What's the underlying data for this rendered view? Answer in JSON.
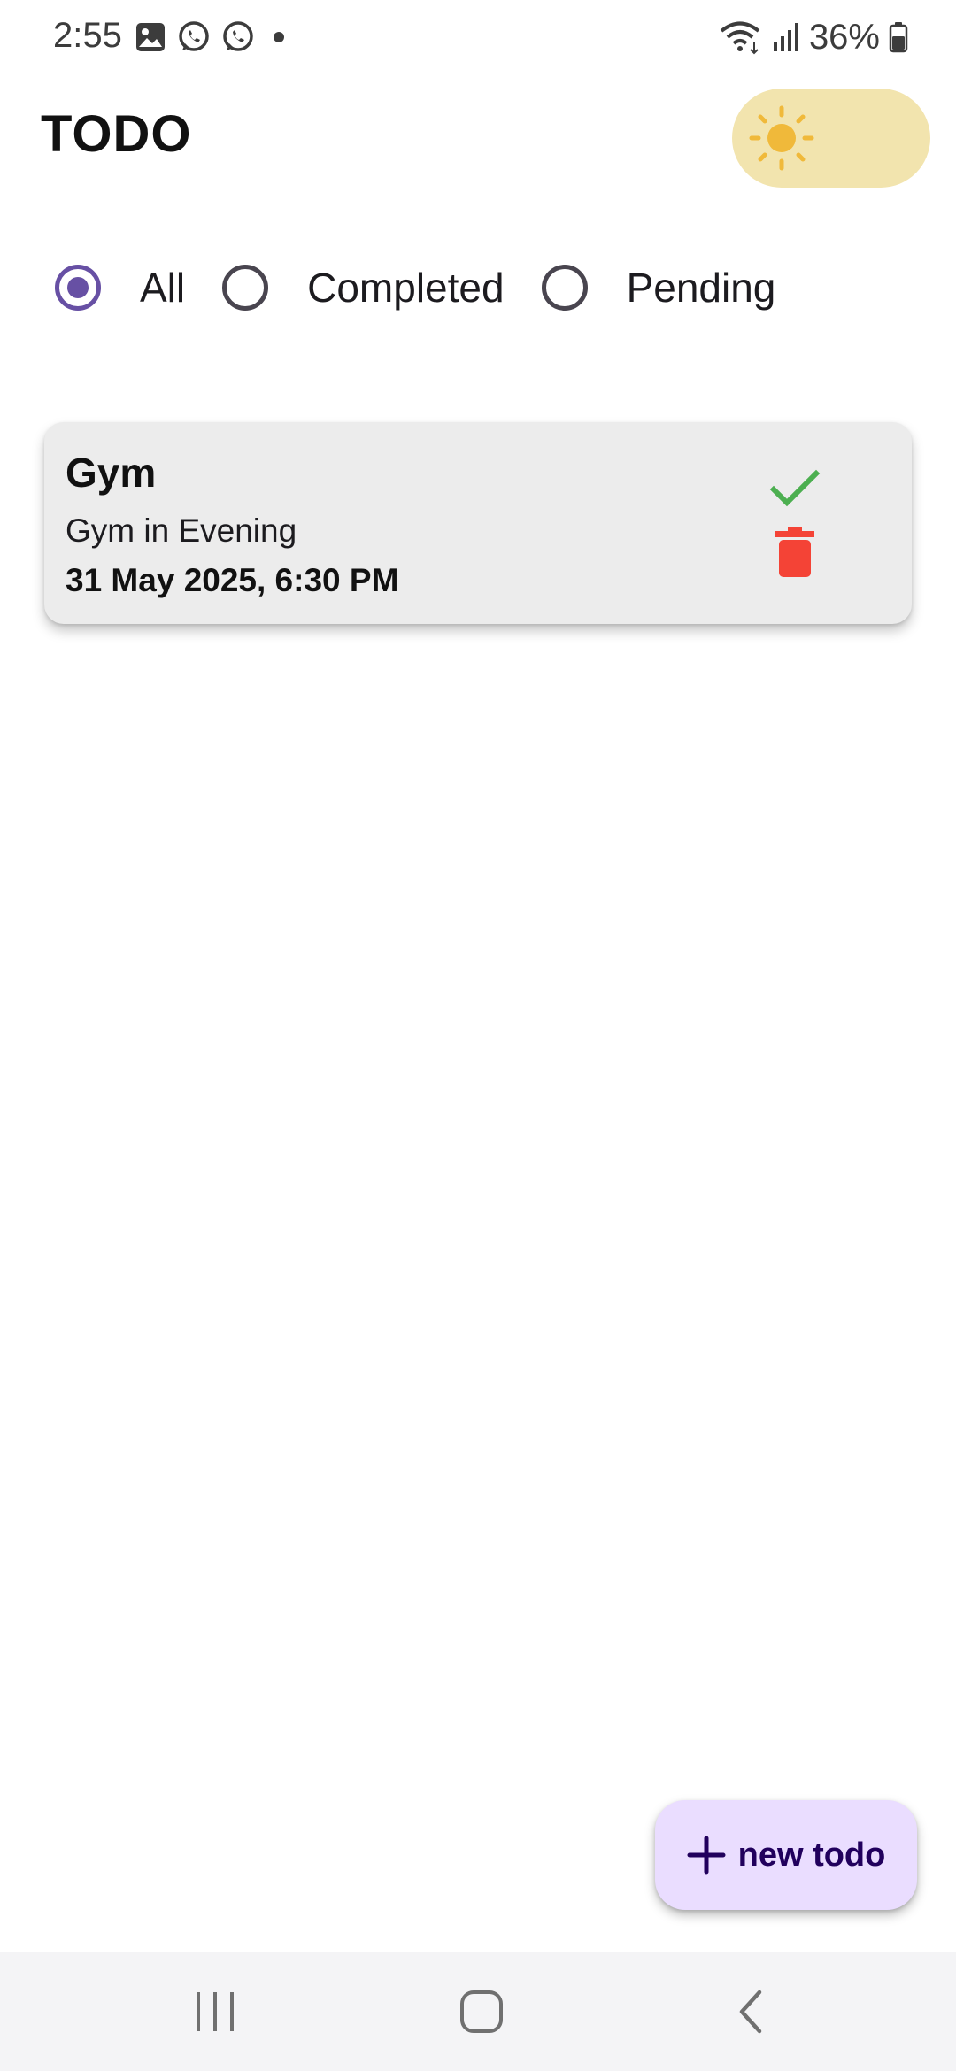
{
  "status_bar": {
    "time": "2:55",
    "battery_percent": "36%",
    "left_icons": [
      "image-icon",
      "whatsapp-icon",
      "whatsapp-icon",
      "dot-icon"
    ],
    "right_icons": [
      "wifi-icon",
      "signal-icon",
      "battery-icon"
    ]
  },
  "header": {
    "title": "TODO",
    "theme_toggle": {
      "mode": "light",
      "icon": "sun-icon",
      "color": "#f2e4ae",
      "icon_color": "#f0b93a"
    }
  },
  "filters": {
    "options": [
      {
        "label": "All",
        "selected": true
      },
      {
        "label": "Completed",
        "selected": false
      },
      {
        "label": "Pending",
        "selected": false
      }
    ],
    "accent_color": "#6750a4"
  },
  "todos": [
    {
      "title": "Gym",
      "description": "Gym in Evening",
      "date": "31 May 2025, 6:30 PM",
      "complete_icon": "check-icon",
      "complete_color": "#4caf50",
      "delete_icon": "trash-icon",
      "delete_color": "#f44336"
    }
  ],
  "fab": {
    "label": "new todo",
    "icon": "plus-icon",
    "color": "#eaddff"
  },
  "nav_bar": {
    "buttons": [
      "recents-icon",
      "home-icon",
      "back-icon"
    ]
  }
}
